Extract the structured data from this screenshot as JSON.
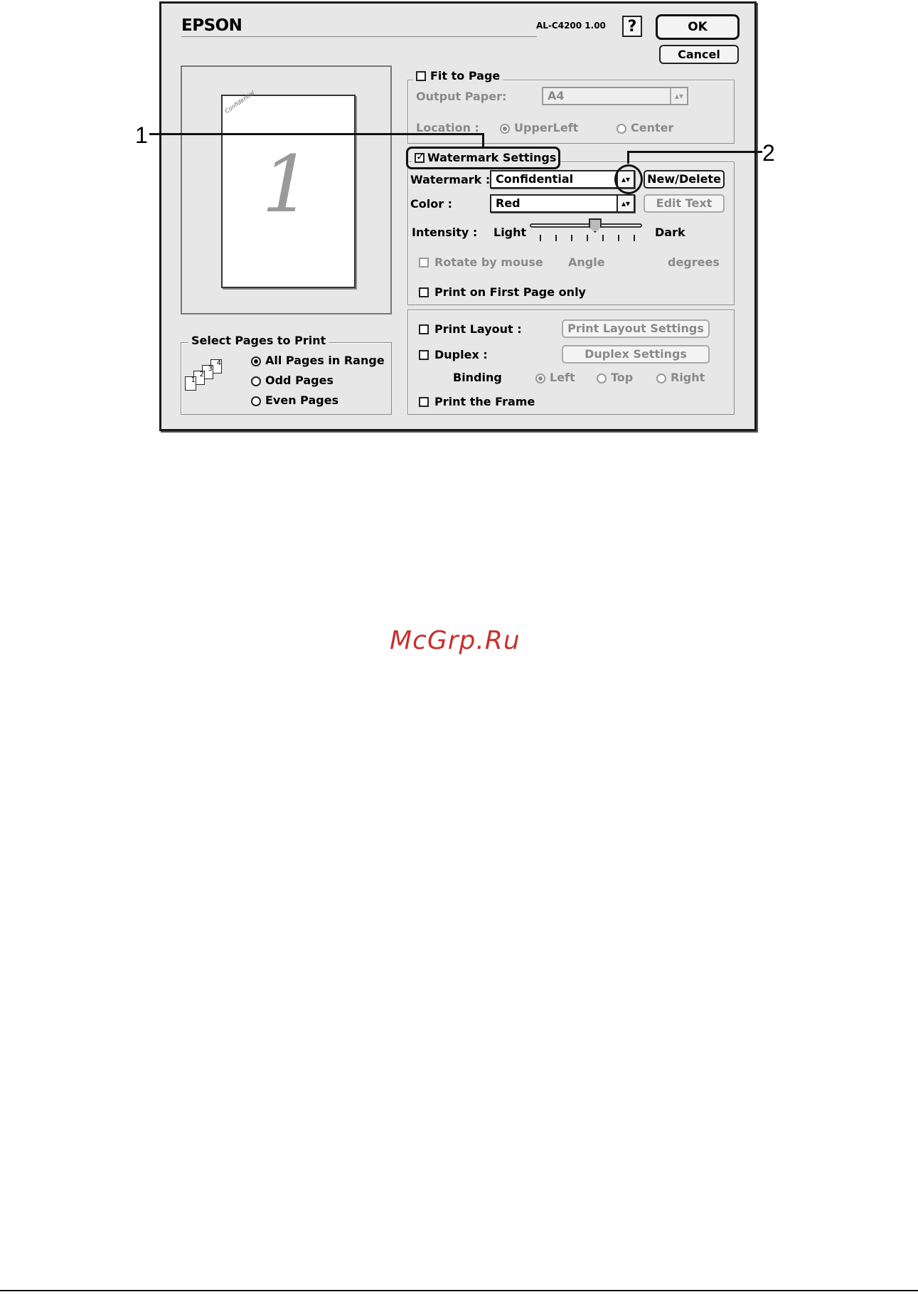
{
  "header": {
    "brand": "EPSON",
    "model": "AL-C4200 1.00",
    "help_label": "?",
    "ok_label": "OK",
    "cancel_label": "Cancel"
  },
  "preview": {
    "page_number": "1",
    "watermark_mini": "Confidential"
  },
  "fit_to_page": {
    "label": "Fit to Page",
    "checked": false,
    "output_paper_label": "Output Paper:",
    "output_paper_value": "A4",
    "location_label": "Location :",
    "location_options": [
      "UpperLeft",
      "Center"
    ],
    "location_selected": "UpperLeft"
  },
  "watermark": {
    "section_label": "Watermark Settings",
    "checked": true,
    "watermark_label": "Watermark :",
    "watermark_value": "Confidential",
    "new_delete_label": "New/Delete",
    "color_label": "Color :",
    "color_value": "Red",
    "edit_text_label": "Edit Text",
    "intensity_label": "Intensity :",
    "intensity_light": "Light",
    "intensity_dark": "Dark",
    "intensity_level": 0.6,
    "rotate_label": "Rotate by mouse",
    "angle_label": "Angle",
    "degrees_label": "degrees",
    "first_page_label": "Print on First Page only"
  },
  "layout": {
    "print_layout_label": "Print Layout :",
    "print_layout_settings": "Print Layout Settings",
    "duplex_label": "Duplex :",
    "duplex_settings": "Duplex Settings",
    "binding_label": "Binding",
    "binding_options": [
      "Left",
      "Top",
      "Right"
    ],
    "binding_selected": "Left",
    "frame_label": "Print the Frame"
  },
  "select_pages": {
    "title": "Select Pages to Print",
    "options": [
      "All Pages in Range",
      "Odd Pages",
      "Even Pages"
    ],
    "selected": "All Pages in Range",
    "icon_numbers": [
      "1",
      "2",
      "3",
      "4"
    ]
  },
  "callouts": [
    "1",
    "2"
  ],
  "footer": {
    "site": "McGrp.Ru"
  }
}
